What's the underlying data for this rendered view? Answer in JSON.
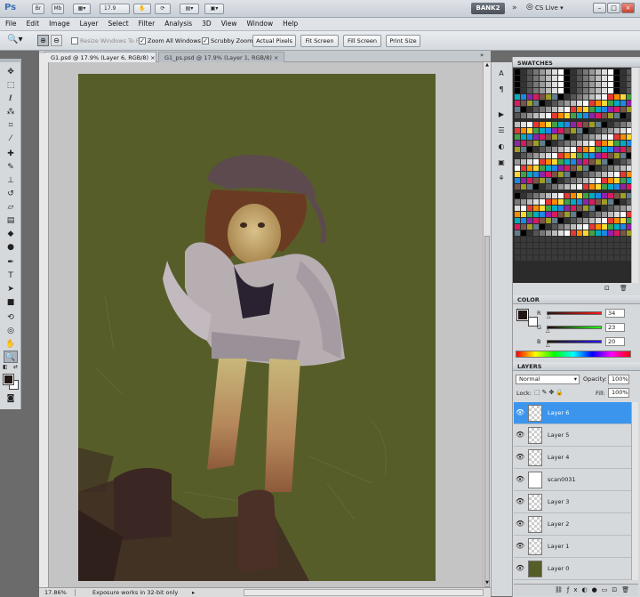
{
  "app": {
    "logo": "Ps",
    "title_buttons": [
      "Br",
      "Mb"
    ],
    "zoom_field": "17.9",
    "workspace_button": "BANK2",
    "cs_live": "CS Live",
    "window_controls": [
      "–",
      "□",
      "×"
    ],
    "colors": {
      "chrome": "#d6d9dc",
      "selection": "#3b95ec",
      "canvas_bg": "#575d29",
      "close": "#c9402f"
    }
  },
  "menu": [
    "File",
    "Edit",
    "Image",
    "Layer",
    "Select",
    "Filter",
    "Analysis",
    "3D",
    "View",
    "Window",
    "Help"
  ],
  "options": {
    "resize_windows": "Resize Windows To Fit",
    "zoom_all": "Zoom All Windows",
    "scrubby_zoom": "Scrubby Zoom",
    "actual_pixels": "Actual Pixels",
    "fit_screen": "Fit Screen",
    "fill_screen": "Fill Screen",
    "print_size": "Print Size"
  },
  "tabs": [
    {
      "label": "G1.psd @ 17.9% (Layer 6, RGB/8)"
    },
    {
      "label": "G1_ps.psd @ 17.9% (Layer 1, RGB/8)"
    }
  ],
  "tools": [
    "move-tool",
    "marquee-tool",
    "lasso-tool",
    "quick-select-tool",
    "crop-tool",
    "eyedropper-tool",
    "healing-tool",
    "brush-tool",
    "clone-stamp-tool",
    "history-brush-tool",
    "eraser-tool",
    "gradient-tool",
    "blur-tool",
    "dodge-tool",
    "pen-tool",
    "type-tool",
    "path-select-tool",
    "shape-tool",
    "3d-rotate-tool",
    "3d-orbit-tool",
    "hand-tool",
    "zoom-tool"
  ],
  "status": {
    "zoom": "17.86%",
    "message": "Exposure works in 32-bit only"
  },
  "panels": {
    "swatches_title": "SWATCHES",
    "color_title": "COLOR",
    "layers_title": "LAYERS"
  },
  "color": {
    "r_label": "R",
    "g_label": "G",
    "b_label": "B",
    "r": "34",
    "g": "23",
    "b": "20",
    "foreground": "#221714"
  },
  "layers_panel": {
    "blend_mode": "Normal",
    "opacity_label": "Opacity:",
    "opacity": "100%",
    "lock_label": "Lock:",
    "fill_label": "Fill:",
    "fill": "100%",
    "layers": [
      {
        "name": "Layer 6",
        "selected": true
      },
      {
        "name": "Layer 5",
        "selected": false
      },
      {
        "name": "Layer 4",
        "selected": false
      },
      {
        "name": "scan0031",
        "selected": false
      },
      {
        "name": "Layer 3",
        "selected": false
      },
      {
        "name": "Layer 2",
        "selected": false
      },
      {
        "name": "Layer 1",
        "selected": false
      },
      {
        "name": "Layer 0",
        "selected": false
      }
    ]
  }
}
